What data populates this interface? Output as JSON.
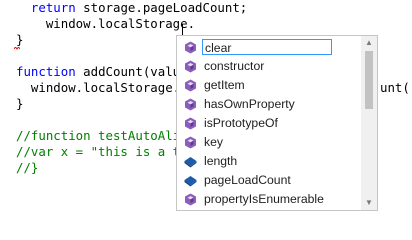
{
  "editor": {
    "lines": [
      {
        "kw": "return",
        "text": " storage.pageLoadCount;"
      },
      {
        "kw": "",
        "text": "  window.localStorage."
      },
      {
        "kw": "",
        "text": "}"
      },
      {
        "kw": "",
        "text": ""
      },
      {
        "kw": "function",
        "text": " addCount(value)"
      },
      {
        "kw": "",
        "text": "  window.localStorage.pa"
      },
      {
        "kw": "",
        "text": "}"
      },
      {
        "kw": "",
        "text": ""
      },
      {
        "cm": "//function testAutoAlign"
      },
      {
        "cm": "//var x = \"this is a tes"
      },
      {
        "cm": "//}"
      }
    ],
    "trailing_text": "unt()"
  },
  "autocomplete": {
    "items": [
      {
        "label": "clear",
        "icon": "method-icon",
        "selected": true
      },
      {
        "label": "constructor",
        "icon": "method-icon"
      },
      {
        "label": "getItem",
        "icon": "method-icon"
      },
      {
        "label": "hasOwnProperty",
        "icon": "method-icon"
      },
      {
        "label": "isPrototypeOf",
        "icon": "method-icon"
      },
      {
        "label": "key",
        "icon": "method-icon"
      },
      {
        "label": "length",
        "icon": "property-icon"
      },
      {
        "label": "pageLoadCount",
        "icon": "property-icon"
      },
      {
        "label": "propertyIsEnumerable",
        "icon": "method-icon"
      }
    ]
  },
  "colors": {
    "keyword": "#0000ff",
    "comment": "#008000",
    "method_icon": "#8c5dbd",
    "property_icon": "#1c5cab",
    "selection_border": "#3399ff"
  }
}
